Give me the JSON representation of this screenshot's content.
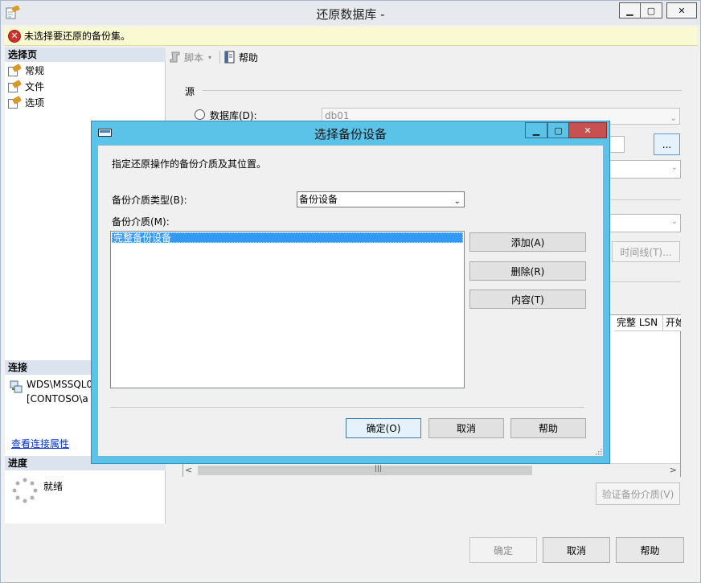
{
  "main_window": {
    "title": "还原数据库 -",
    "min_glyph": "▁",
    "max_glyph": "▢",
    "close_glyph": "✕"
  },
  "error_bar": {
    "icon_glyph": "✕",
    "text": "未选择要还原的备份集。"
  },
  "left_pane": {
    "pages_header": "选择页",
    "pages": [
      {
        "label": "常规"
      },
      {
        "label": "文件"
      },
      {
        "label": "选项"
      }
    ],
    "connection_header": "连接",
    "connection_server": "WDS\\MSSQL0",
    "connection_user": "[CONTOSO\\a",
    "connection_link": "查看连接属性",
    "progress_header": "进度",
    "progress_status": "就绪"
  },
  "toolbar": {
    "script_label": "脚本",
    "script_caret": "▾",
    "help_label": "帮助"
  },
  "source": {
    "section_label": "源",
    "database_radio_label": "数据库(D):",
    "database_value": "db01",
    "dropdown_glyph": "⌄",
    "browse_label": "...",
    "timeline_label": "时间线(T)...",
    "grid_columns": [
      "完整 LSN",
      "开始"
    ],
    "scroll_left": "<",
    "scroll_grip": "|||",
    "scroll_right": ">",
    "verify_label": "验证备份介质(V)"
  },
  "bottom_buttons": {
    "ok": "确定",
    "cancel": "取消",
    "help": "帮助"
  },
  "dialog": {
    "title": "选择备份设备",
    "min_glyph": "▁",
    "max_glyph": "▢",
    "close_glyph": "✕",
    "description": "指定还原操作的备份介质及其位置。",
    "media_type_label": "备份介质类型(B):",
    "media_type_value": "备份设备",
    "dropdown_glyph": "⌄",
    "media_label": "备份介质(M):",
    "media_items": [
      "完整备份设备"
    ],
    "add_label": "添加(A)",
    "delete_label": "删除(R)",
    "contents_label": "内容(T)",
    "ok_label": "确定(O)",
    "cancel_label": "取消",
    "help_label": "帮助"
  },
  "colors": {
    "dialog_frame": "#5cc3e8",
    "dialog_close": "#c75050",
    "selection": "#3399ff",
    "error_bar_bg": "#fafad2",
    "error_icon": "#d0312d",
    "link": "#0033cc",
    "pane_header": "#dbe4ee"
  }
}
